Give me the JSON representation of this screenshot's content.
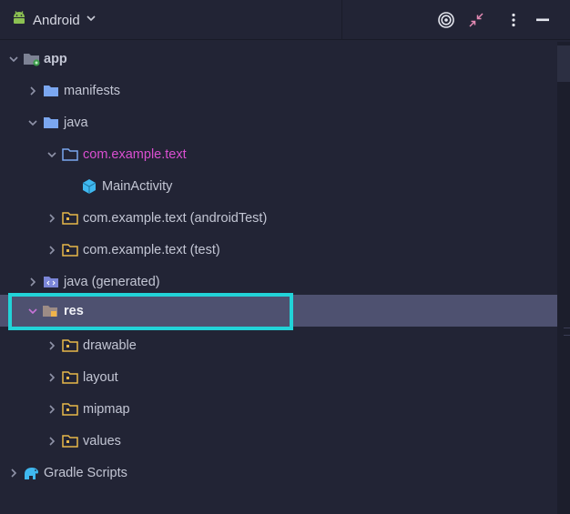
{
  "toolbar": {
    "view_label": "Android",
    "icons": [
      "android-icon",
      "chevron-down-icon",
      "target-icon",
      "collapse-icon",
      "more-vertical-icon",
      "minimize-icon"
    ]
  },
  "tree": {
    "app": "app",
    "manifests": "manifests",
    "java": "java",
    "pkg_main": "com.example.text",
    "main_activity": "MainActivity",
    "pkg_android_test": "com.example.text (androidTest)",
    "pkg_test": "com.example.text (test)",
    "java_generated": "java (generated)",
    "res": "res",
    "drawable": "drawable",
    "layout": "layout",
    "mipmap": "mipmap",
    "values": "values",
    "gradle_scripts": "Gradle Scripts"
  },
  "colors": {
    "background": "#222435",
    "selected_row": "#4e5170",
    "highlight_box": "#22d3d8",
    "package_open_text": "#d94fd0",
    "folder_blue": "#7ba7f0",
    "folder_yellow": "#e8b84a",
    "activity_icon": "#3fb8ef",
    "android_green": "#8cc152"
  }
}
